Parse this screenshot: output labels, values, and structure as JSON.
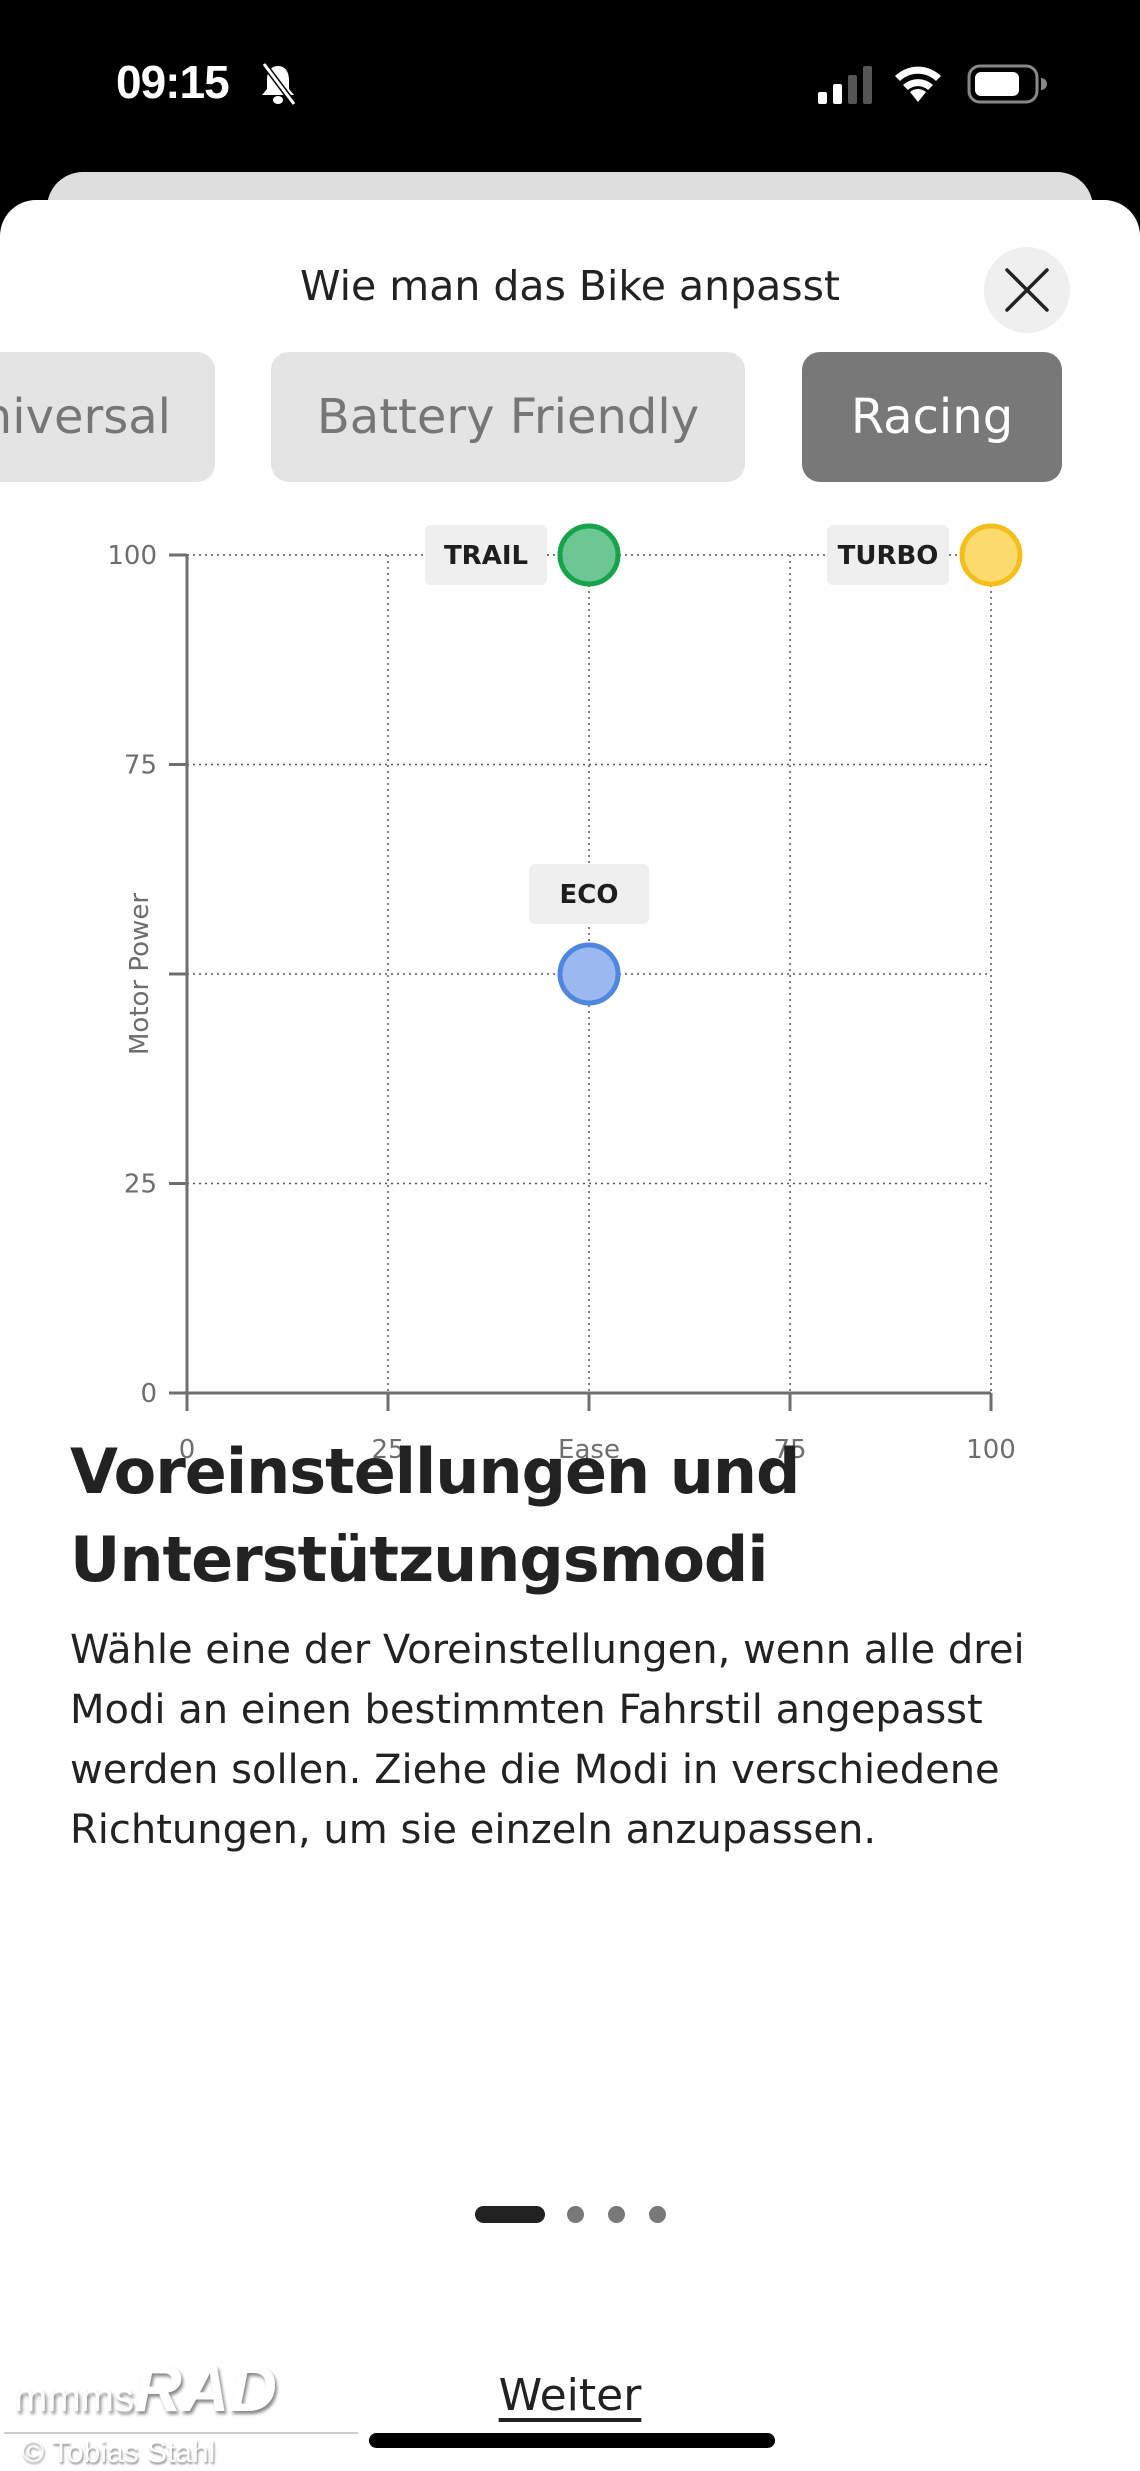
{
  "status_bar": {
    "time": "09:15",
    "icons": [
      "bell-slash-icon",
      "cellular-signal-icon",
      "wifi-icon",
      "battery-icon"
    ]
  },
  "sheet": {
    "title": "Wie man das Bike anpasst",
    "close_icon": "close-icon"
  },
  "tabs": [
    {
      "label": "Universal",
      "active": false
    },
    {
      "label": "Battery Friendly",
      "active": false
    },
    {
      "label": "Racing",
      "active": true
    }
  ],
  "chart_data": {
    "type": "scatter",
    "xlabel": "Ease",
    "ylabel": "Motor Power",
    "xlim": [
      0,
      100
    ],
    "ylim": [
      0,
      100
    ],
    "x_ticks": [
      0,
      25,
      50,
      75,
      100
    ],
    "x_tick_labels": [
      "0",
      "25",
      "Ease",
      "75",
      "100"
    ],
    "y_ticks": [
      0,
      25,
      50,
      75,
      100
    ],
    "y_tick_labels": [
      "0",
      "25",
      "",
      "75",
      "100"
    ],
    "grid": true,
    "points": [
      {
        "label": "TRAIL",
        "x": 50,
        "y": 100,
        "fill": "#6cc794",
        "stroke": "#16a34a",
        "label_position": "left"
      },
      {
        "label": "TURBO",
        "x": 100,
        "y": 100,
        "fill": "#fcdb6e",
        "stroke": "#f5bf1b",
        "label_position": "left"
      },
      {
        "label": "ECO",
        "x": 50,
        "y": 50,
        "fill": "#9bb8f0",
        "stroke": "#4f86e0",
        "label_position": "top"
      }
    ]
  },
  "content": {
    "title": "Voreinstellungen und Unterstützungsmodi",
    "body": "Wähle eine der Voreinstellungen, wenn alle drei Modi an einen bestimmten Fahrstil angepasst werden sollen. Ziehe die Modi in verschiedene Richtungen, um sie einzeln anzupassen."
  },
  "pager": {
    "count": 4,
    "current": 1
  },
  "next_label": "Weiter",
  "watermark": {
    "brand_small": "mmms",
    "brand_large": "RAD",
    "copyright": "© Tobias Stahl"
  }
}
